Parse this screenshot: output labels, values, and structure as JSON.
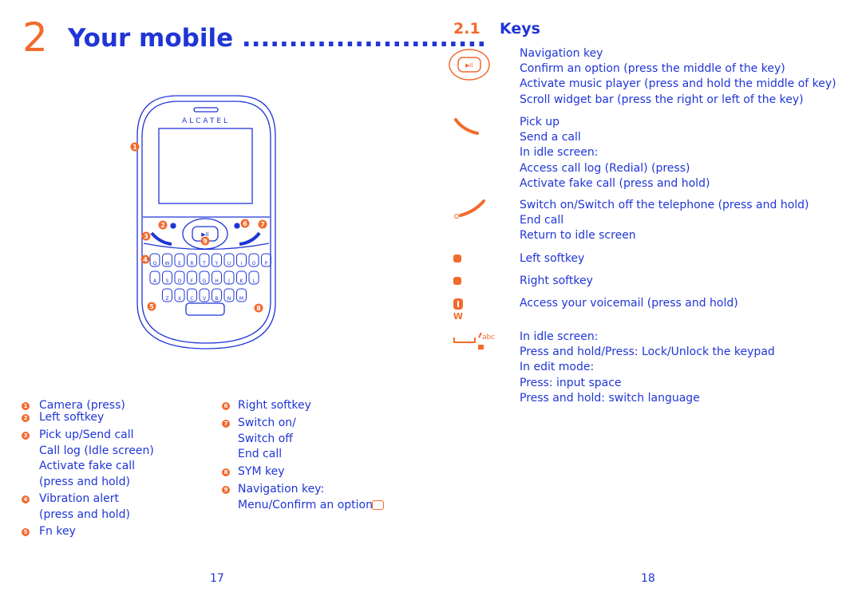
{
  "left_page": {
    "chapter_number": "2",
    "chapter_title": "Your mobile",
    "chapter_dots": "..........................",
    "phone": {
      "brand": "ALCATEL",
      "keys": [
        [
          "Q",
          "W",
          "E",
          "R",
          "T",
          "Y",
          "U",
          "I",
          "O",
          "P"
        ],
        [
          "A",
          "S",
          "D",
          "F",
          "G",
          "H",
          "J",
          "K",
          "L"
        ],
        [
          "Z",
          "X",
          "C",
          "V",
          "B",
          "N",
          "M"
        ]
      ],
      "callouts": [
        "1",
        "2",
        "3",
        "4",
        "5",
        "6",
        "7",
        "8",
        "9"
      ]
    },
    "legend_left": [
      {
        "num": "1",
        "lines": [
          "Camera (press)"
        ]
      },
      {
        "num": "2",
        "lines": [
          "Left softkey"
        ]
      },
      {
        "num": "3",
        "lines": [
          "Pick up/Send call",
          "Call log (Idle screen)",
          "Activate fake call",
          "(press and hold)"
        ]
      },
      {
        "num": "4",
        "lines": [
          "Vibration alert",
          "(press and hold)"
        ]
      },
      {
        "num": "5",
        "lines": [
          "Fn key"
        ]
      }
    ],
    "legend_right": [
      {
        "num": "6",
        "lines": [
          "Right softkey"
        ]
      },
      {
        "num": "7",
        "lines": [
          "Switch on/",
          "Switch off",
          "End call"
        ]
      },
      {
        "num": "8",
        "lines": [
          "SYM key"
        ]
      },
      {
        "num": "9",
        "lines": [
          "Navigation key:",
          "Menu/Confirm an option"
        ]
      }
    ],
    "page_number": "17"
  },
  "right_page": {
    "section_number": "2.1",
    "section_title": "Keys",
    "keys": [
      {
        "icon": "navigation-key-icon",
        "lines": [
          "Navigation key",
          "Confirm an option (press the middle of the key)",
          "Activate music player (press and hold the middle of key)",
          "Scroll widget bar (press the right or left of the key)"
        ]
      },
      {
        "icon": "pick-up-key-icon",
        "lines": [
          "Pick up",
          "Send a call",
          "In idle screen:",
          "Access call log (Redial) (press)",
          "Activate fake call (press and hold)"
        ]
      },
      {
        "icon": "end-call-key-icon",
        "lines": [
          "Switch on/Switch off the telephone (press and hold)",
          "End call",
          "Return to idle screen"
        ]
      },
      {
        "icon": "left-softkey-icon",
        "lines": [
          "Left softkey"
        ]
      },
      {
        "icon": "right-softkey-icon",
        "lines": [
          "Right softkey"
        ]
      },
      {
        "icon": "voicemail-key-icon",
        "icon_label": "W",
        "lines": [
          "Access your voicemail (press and hold)"
        ]
      },
      {
        "icon": "space-lock-key-icon",
        "icon_label": "abc",
        "lines": [
          "In idle screen:",
          "Press and hold/Press: Lock/Unlock the keypad",
          "In edit mode:",
          "Press: input space",
          "Press and hold: switch language"
        ]
      }
    ],
    "page_number": "18"
  },
  "colors": {
    "text": "#1f35d6",
    "accent": "#f26a2c"
  }
}
